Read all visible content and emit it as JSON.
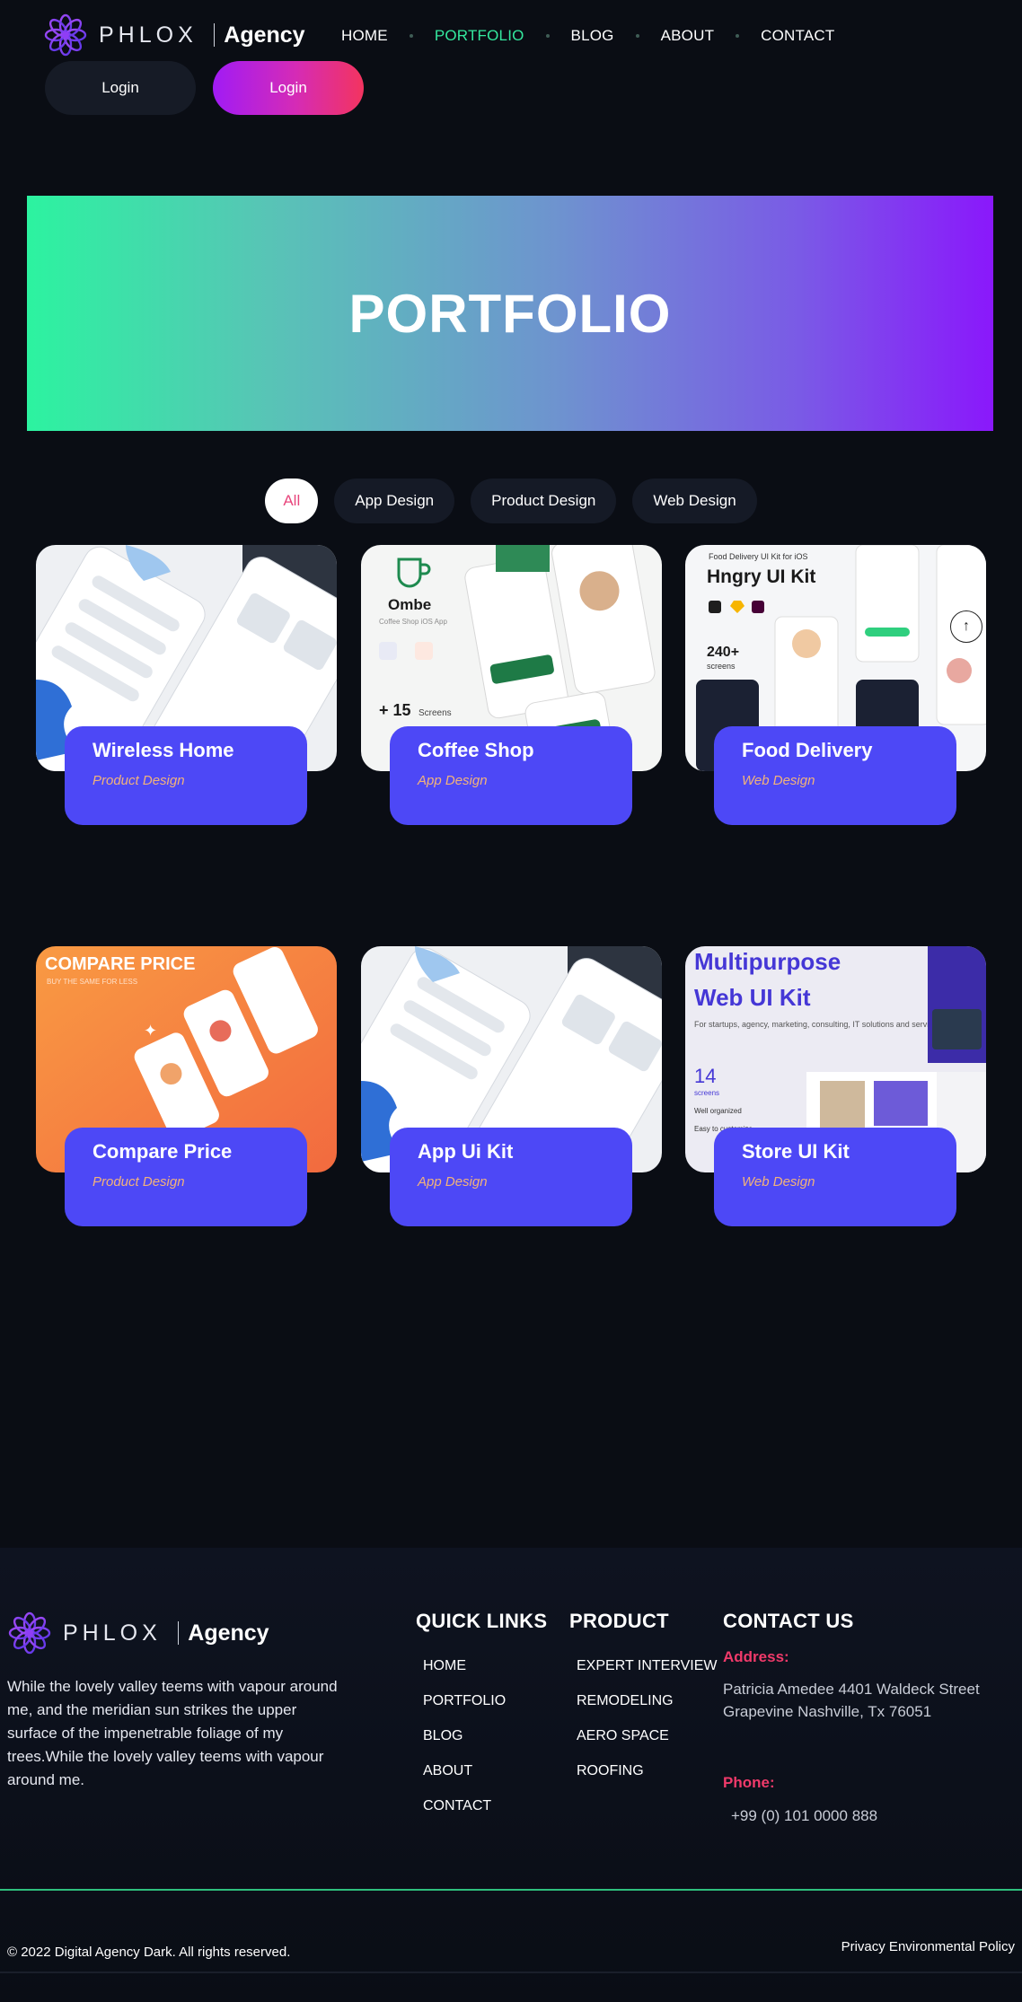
{
  "brand": {
    "name": "PHLOX",
    "suffix": "Agency"
  },
  "nav": {
    "items": [
      {
        "label": "HOME",
        "active": false
      },
      {
        "label": "PORTFOLIO",
        "active": true
      },
      {
        "label": "BLOG",
        "active": false
      },
      {
        "label": "ABOUT",
        "active": false
      },
      {
        "label": "CONTACT",
        "active": false
      }
    ]
  },
  "auth": {
    "login_label": "Login",
    "login_alt_label": "Login"
  },
  "hero": {
    "title": "PORTFOLIO"
  },
  "filters": [
    {
      "label": "All",
      "active": true
    },
    {
      "label": "App Design",
      "active": false
    },
    {
      "label": "Product Design",
      "active": false
    },
    {
      "label": "Web Design",
      "active": false
    }
  ],
  "portfolio": [
    {
      "title": "Wireless Home",
      "category": "Product Design"
    },
    {
      "title": "Coffee Shop",
      "category": "App Design"
    },
    {
      "title": "Food Delivery",
      "category": "Web Design"
    },
    {
      "title": "Compare Price",
      "category": "Product Design"
    },
    {
      "title": "App Ui Kit",
      "category": "App Design"
    },
    {
      "title": "Store UI Kit",
      "category": "Web Design"
    }
  ],
  "thumb_text": {
    "ombe": "Ombe",
    "ombe_sub": "Coffee Shop iOS App",
    "screens": "+ 15",
    "screens_label": "Screens",
    "hungry": "Hngry UI Kit",
    "hungry_top": "Food Delivery UI Kit for iOS",
    "count_240": "240+",
    "count_240_label": "screens",
    "compare": "COMPARE PRICE",
    "compare_sub": "BUY THE SAME FOR LESS",
    "multi_1": "Multipurpose",
    "multi_2": "Web UI Kit",
    "multi_desc": "For startups, agency, marketing, consulting, IT solutions and services company",
    "count_14": "14",
    "count_14_label": "screens",
    "well": "Well organized",
    "easy": "Easy to customize"
  },
  "footer": {
    "about": "While the lovely valley teems with vapour around me, and the meridian sun strikes the upper surface of the impenetrable foliage of my trees.While the lovely valley teems with vapour around me.",
    "quick_links_title": "QUICK LINKS",
    "quick_links": [
      "HOME",
      "PORTFOLIO",
      "BLOG",
      "ABOUT",
      "CONTACT"
    ],
    "product_title": "PRODUCT",
    "product_links": [
      "EXPERT INTERVIEW",
      "REMODELING",
      "AERO SPACE",
      "ROOFING"
    ],
    "contact_title": "CONTACT US",
    "address_label": "Address:",
    "address": "Patricia Amedee 4401 Waldeck Street Grapevine Nashville, Tx 76051",
    "phone_label": "Phone:",
    "phone": "+99 (0) 101 0000 888",
    "copyright": "© 2022 Digital Agency Dark. All rights reserved.",
    "policy": "Privacy Environmental Policy"
  },
  "colors": {
    "background": "#0a0d14",
    "accent_green": "#34e89e",
    "card_blue": "#4d48f6",
    "category_orange": "#f2b37a",
    "contact_red": "#f03a6a",
    "filter_active_text": "#e8467c"
  }
}
